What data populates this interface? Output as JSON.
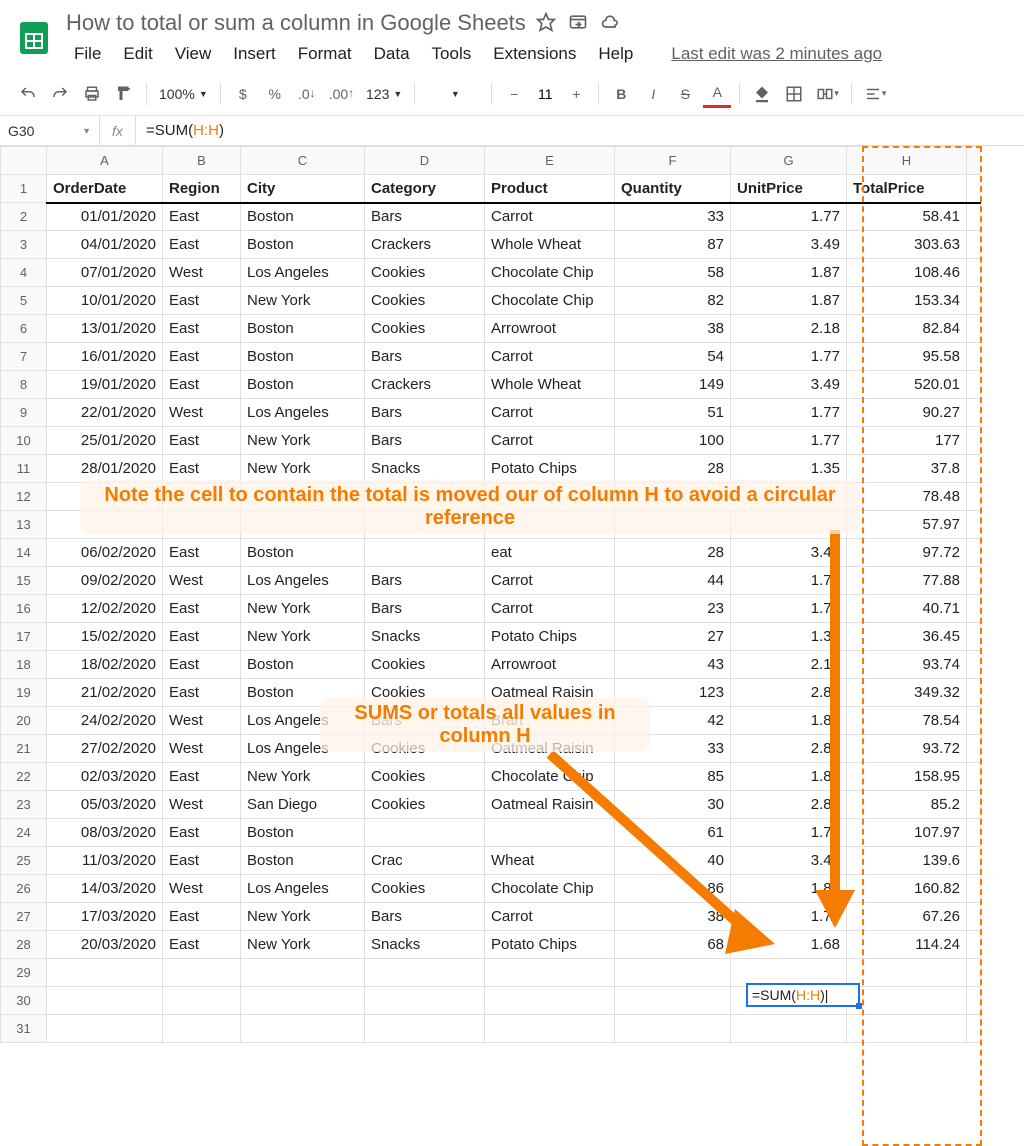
{
  "doc_title": "How to total or sum a column in Google Sheets",
  "menu": {
    "file": "File",
    "edit": "Edit",
    "view": "View",
    "insert": "Insert",
    "format": "Format",
    "data": "Data",
    "tools": "Tools",
    "extensions": "Extensions",
    "help": "Help"
  },
  "last_edit": "Last edit was 2 minutes ago",
  "toolbar": {
    "zoom": "100%",
    "currency": "$",
    "percent": "%",
    "dec_dec": ".0",
    "inc_dec": ".00",
    "numfmt": "123",
    "font_size": "11"
  },
  "name_box": "G30",
  "formula_prefix": "=SUM(",
  "formula_range": "H:H",
  "formula_suffix": ")",
  "columns": [
    "A",
    "B",
    "C",
    "D",
    "E",
    "F",
    "G",
    "H"
  ],
  "headers": {
    "A": "OrderDate",
    "B": "Region",
    "C": "City",
    "D": "Category",
    "E": "Product",
    "F": "Quantity",
    "G": "UnitPrice",
    "H": "TotalPrice"
  },
  "rows": [
    {
      "n": 2,
      "A": "01/01/2020",
      "B": "East",
      "C": "Boston",
      "D": "Bars",
      "E": "Carrot",
      "F": "33",
      "G": "1.77",
      "H": "58.41"
    },
    {
      "n": 3,
      "A": "04/01/2020",
      "B": "East",
      "C": "Boston",
      "D": "Crackers",
      "E": "Whole Wheat",
      "F": "87",
      "G": "3.49",
      "H": "303.63"
    },
    {
      "n": 4,
      "A": "07/01/2020",
      "B": "West",
      "C": "Los Angeles",
      "D": "Cookies",
      "E": "Chocolate Chip",
      "F": "58",
      "G": "1.87",
      "H": "108.46"
    },
    {
      "n": 5,
      "A": "10/01/2020",
      "B": "East",
      "C": "New York",
      "D": "Cookies",
      "E": "Chocolate Chip",
      "F": "82",
      "G": "1.87",
      "H": "153.34"
    },
    {
      "n": 6,
      "A": "13/01/2020",
      "B": "East",
      "C": "Boston",
      "D": "Cookies",
      "E": "Arrowroot",
      "F": "38",
      "G": "2.18",
      "H": "82.84"
    },
    {
      "n": 7,
      "A": "16/01/2020",
      "B": "East",
      "C": "Boston",
      "D": "Bars",
      "E": "Carrot",
      "F": "54",
      "G": "1.77",
      "H": "95.58"
    },
    {
      "n": 8,
      "A": "19/01/2020",
      "B": "East",
      "C": "Boston",
      "D": "Crackers",
      "E": "Whole Wheat",
      "F": "149",
      "G": "3.49",
      "H": "520.01"
    },
    {
      "n": 9,
      "A": "22/01/2020",
      "B": "West",
      "C": "Los Angeles",
      "D": "Bars",
      "E": "Carrot",
      "F": "51",
      "G": "1.77",
      "H": "90.27"
    },
    {
      "n": 10,
      "A": "25/01/2020",
      "B": "East",
      "C": "New York",
      "D": "Bars",
      "E": "Carrot",
      "F": "100",
      "G": "1.77",
      "H": "177"
    },
    {
      "n": 11,
      "A": "28/01/2020",
      "B": "East",
      "C": "New York",
      "D": "Snacks",
      "E": "Potato Chips",
      "F": "28",
      "G": "1.35",
      "H": "37.8"
    },
    {
      "n": 12,
      "A": "",
      "B": "",
      "C": "",
      "D": "",
      "E": "",
      "F": "",
      "G": "",
      "H": "78.48"
    },
    {
      "n": 13,
      "A": "",
      "B": "",
      "C": "",
      "D": "",
      "E": "",
      "F": "",
      "G": "",
      "H": "57.97"
    },
    {
      "n": 14,
      "A": "06/02/2020",
      "B": "East",
      "C": "Boston",
      "D": "",
      "E": "eat",
      "F": "28",
      "G": "3.49",
      "H": "97.72"
    },
    {
      "n": 15,
      "A": "09/02/2020",
      "B": "West",
      "C": "Los Angeles",
      "D": "Bars",
      "E": "Carrot",
      "F": "44",
      "G": "1.77",
      "H": "77.88"
    },
    {
      "n": 16,
      "A": "12/02/2020",
      "B": "East",
      "C": "New York",
      "D": "Bars",
      "E": "Carrot",
      "F": "23",
      "G": "1.77",
      "H": "40.71"
    },
    {
      "n": 17,
      "A": "15/02/2020",
      "B": "East",
      "C": "New York",
      "D": "Snacks",
      "E": "Potato Chips",
      "F": "27",
      "G": "1.35",
      "H": "36.45"
    },
    {
      "n": 18,
      "A": "18/02/2020",
      "B": "East",
      "C": "Boston",
      "D": "Cookies",
      "E": "Arrowroot",
      "F": "43",
      "G": "2.18",
      "H": "93.74"
    },
    {
      "n": 19,
      "A": "21/02/2020",
      "B": "East",
      "C": "Boston",
      "D": "Cookies",
      "E": "Oatmeal Raisin",
      "F": "123",
      "G": "2.84",
      "H": "349.32"
    },
    {
      "n": 20,
      "A": "24/02/2020",
      "B": "West",
      "C": "Los Angeles",
      "D": "Bars",
      "E": "Bran",
      "F": "42",
      "G": "1.87",
      "H": "78.54"
    },
    {
      "n": 21,
      "A": "27/02/2020",
      "B": "West",
      "C": "Los Angeles",
      "D": "Cookies",
      "E": "Oatmeal Raisin",
      "F": "33",
      "G": "2.84",
      "H": "93.72"
    },
    {
      "n": 22,
      "A": "02/03/2020",
      "B": "East",
      "C": "New York",
      "D": "Cookies",
      "E": "Chocolate Chip",
      "F": "85",
      "G": "1.87",
      "H": "158.95"
    },
    {
      "n": 23,
      "A": "05/03/2020",
      "B": "West",
      "C": "San Diego",
      "D": "Cookies",
      "E": "Oatmeal Raisin",
      "F": "30",
      "G": "2.84",
      "H": "85.2"
    },
    {
      "n": 24,
      "A": "08/03/2020",
      "B": "East",
      "C": "Boston",
      "D": "",
      "E": "",
      "F": "61",
      "G": "1.77",
      "H": "107.97"
    },
    {
      "n": 25,
      "A": "11/03/2020",
      "B": "East",
      "C": "Boston",
      "D": "Crac",
      "E": "Wheat",
      "F": "40",
      "G": "3.49",
      "H": "139.6"
    },
    {
      "n": 26,
      "A": "14/03/2020",
      "B": "West",
      "C": "Los Angeles",
      "D": "Cookies",
      "E": "Chocolate Chip",
      "F": "86",
      "G": "1.87",
      "H": "160.82"
    },
    {
      "n": 27,
      "A": "17/03/2020",
      "B": "East",
      "C": "New York",
      "D": "Bars",
      "E": "Carrot",
      "F": "38",
      "G": "1.77",
      "H": "67.26"
    },
    {
      "n": 28,
      "A": "20/03/2020",
      "B": "East",
      "C": "New York",
      "D": "Snacks",
      "E": "Potato Chips",
      "F": "68",
      "G": "1.68",
      "H": "114.24"
    }
  ],
  "empty_rows": [
    29,
    30,
    31
  ],
  "cell_G30_prefix": "=SUM(",
  "cell_G30_range": "H:H",
  "cell_G30_suffix": ")",
  "annotation1": "Note the cell to contain the total is moved our of column H to avoid a circular reference",
  "annotation2": "SUMS or totals all values in column H"
}
